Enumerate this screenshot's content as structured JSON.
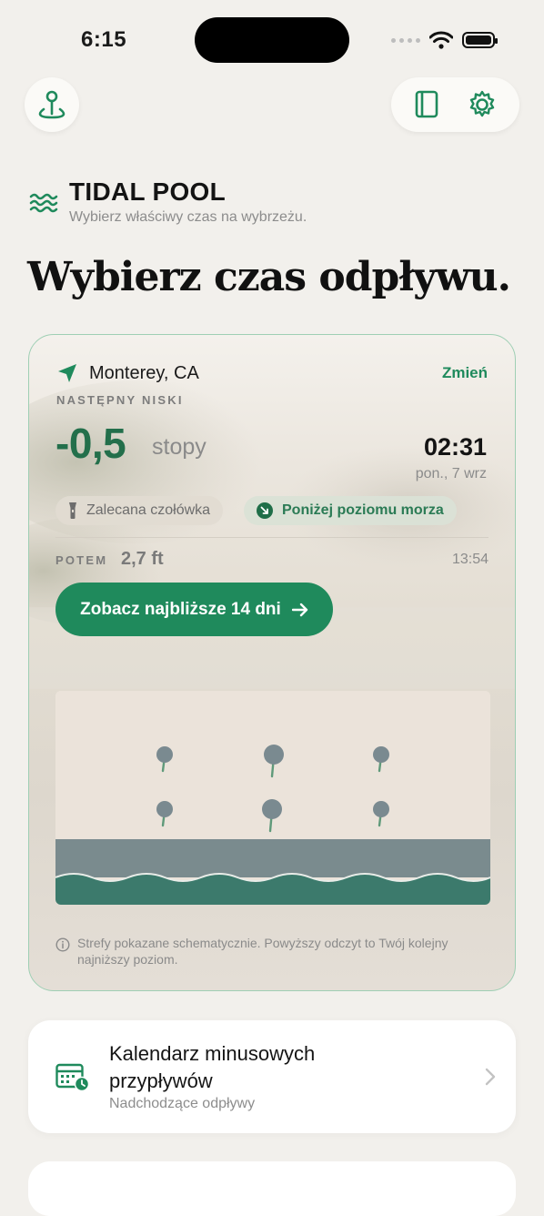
{
  "status": {
    "time": "6:15"
  },
  "brand": {
    "name": "TIDAL POOL",
    "tagline": "Wybierz właściwy czas na wybrzeżu."
  },
  "headline": "Wybierz czas odpływu.",
  "tide_card": {
    "location": "Monterey, CA",
    "change_label": "Zmień",
    "next_low_label": "NASTĘPNY NISKI",
    "level_value": "-0,5",
    "level_unit": "stopy",
    "time": "02:31",
    "date": "pon., 7 wrz",
    "chip_headlamp": "Zalecana czołówka",
    "chip_below_sea": "Poniżej poziomu morza",
    "then_label": "POTEM",
    "then_value": "2,7 ft",
    "then_time": "13:54",
    "cta_label": "Zobacz najbliższe 14 dni",
    "note": "Strefy pokazane schematycznie. Powyższy odczyt to Twój kolejny najniższy poziom."
  },
  "calendar_card": {
    "title": "Kalendarz minusowych przypływów",
    "subtitle": "Nadchodzące odpływy"
  },
  "colors": {
    "accent": "#1f8a5c",
    "level": "#236f4b",
    "background": "#f2f0ec",
    "card_border": "#9fcfb4"
  },
  "icons": {
    "location_button": "map-pin-icon",
    "guide_button": "book-icon",
    "settings_button": "gear-icon",
    "brand": "waves-icon",
    "location": "location-arrow-icon",
    "headlamp": "flashlight-icon",
    "below_sea": "arrow-down-right-icon",
    "cta": "arrow-right-icon",
    "note": "info-icon",
    "calendar": "calendar-clock-icon",
    "chevron": "chevron-right-icon"
  }
}
